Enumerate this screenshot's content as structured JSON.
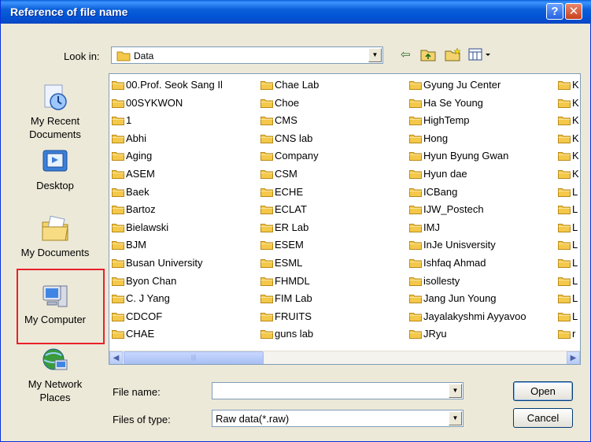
{
  "title": "Reference of file name",
  "lookin": {
    "label": "Look in:",
    "value": "Data"
  },
  "places": [
    {
      "key": "recent",
      "label": "My Recent Documents",
      "icon": "recent-documents-icon"
    },
    {
      "key": "desktop",
      "label": "Desktop",
      "icon": "desktop-icon"
    },
    {
      "key": "documents",
      "label": "My Documents",
      "icon": "my-documents-icon"
    },
    {
      "key": "computer",
      "label": "My Computer",
      "icon": "my-computer-icon"
    },
    {
      "key": "network",
      "label": "My Network Places",
      "icon": "network-places-icon"
    }
  ],
  "files": {
    "col1": [
      "00.Prof. Seok Sang Il",
      "00SYKWON",
      "1",
      "Abhi",
      "Aging",
      "ASEM",
      "Baek",
      "Bartoz",
      "Bielawski",
      "BJM",
      "Busan University",
      "Byon Chan",
      "C. J Yang",
      "CDCOF",
      "CHAE"
    ],
    "col2": [
      "Chae Lab",
      "Choe",
      "CMS",
      "CNS lab",
      "Company",
      "CSM",
      "ECHE",
      "ECLAT",
      "ER Lab",
      "ESEM",
      "ESML",
      "FHMDL",
      "FIM Lab",
      "FRUITS",
      "guns lab"
    ],
    "col3": [
      "Gyung Ju Center",
      "Ha Se Young",
      "HighTemp",
      "Hong",
      "Hyun Byung Gwan",
      "Hyun dae",
      "ICBang",
      "IJW_Postech",
      "IMJ",
      "InJe Unisversity",
      "Ishfaq Ahmad",
      "isollesty",
      "Jang Jun Young",
      "Jayalakyshmi Ayyavoo",
      "JRyu"
    ],
    "col4": [
      "K",
      "K",
      "K",
      "K",
      "K",
      "K",
      "L",
      "L",
      "L",
      "L",
      "L",
      "L",
      "L",
      "L",
      "r"
    ]
  },
  "filename": {
    "label": "File name:",
    "value": ""
  },
  "filetype": {
    "label": "Files of type:",
    "value": "Raw data(*.raw)"
  },
  "buttons": {
    "open": "Open",
    "cancel": "Cancel"
  },
  "colors": {
    "titlebar": "#0a5fd8",
    "window": "#ece9d8",
    "highlight": "#e8202a",
    "folder": "#f4c84a"
  }
}
